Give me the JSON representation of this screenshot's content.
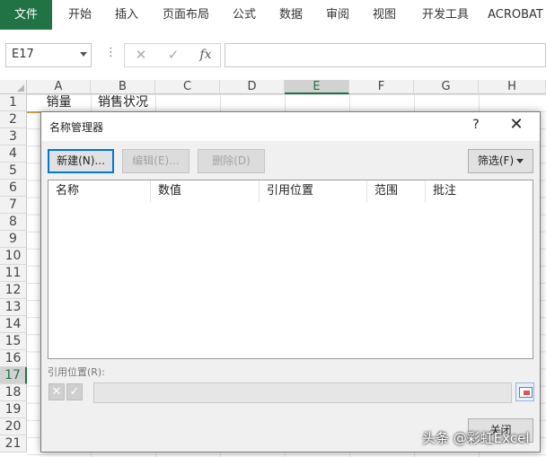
{
  "ribbon": {
    "tabs": [
      "文件",
      "开始",
      "插入",
      "页面布局",
      "公式",
      "数据",
      "审阅",
      "视图",
      "开发工具",
      "ACROBAT"
    ]
  },
  "formula_bar": {
    "name_box": "E17",
    "dots": "⋮",
    "cancel_icon": "✕",
    "enter_icon": "✓",
    "fx_label": "fx",
    "formula": ""
  },
  "sheet": {
    "columns": [
      "A",
      "B",
      "C",
      "D",
      "E",
      "F",
      "G",
      "H"
    ],
    "selected_column": "E",
    "rows": [
      "1",
      "2",
      "3",
      "4",
      "5",
      "6",
      "7",
      "8",
      "9",
      "10",
      "11",
      "12",
      "13",
      "14",
      "15",
      "16",
      "17",
      "18",
      "19",
      "20",
      "21"
    ],
    "selected_row": "17",
    "cells": {
      "A1": "销量",
      "B1": "销售状况"
    }
  },
  "dialog": {
    "title": "名称管理器",
    "help": "?",
    "close": "✕",
    "new_button": "新建(N)...",
    "edit_button": "编辑(E)...",
    "delete_button": "删除(D)",
    "filter_button": "筛选(F)",
    "columns": [
      "名称",
      "数值",
      "引用位置",
      "范围",
      "批注"
    ],
    "refers_to_label": "引用位置(R):",
    "refers_to_value": "",
    "close_button": "关闭"
  },
  "watermark": "头条 @彩虹Excel",
  "colors": {
    "accent": "#217346",
    "focus": "#0078d7"
  }
}
